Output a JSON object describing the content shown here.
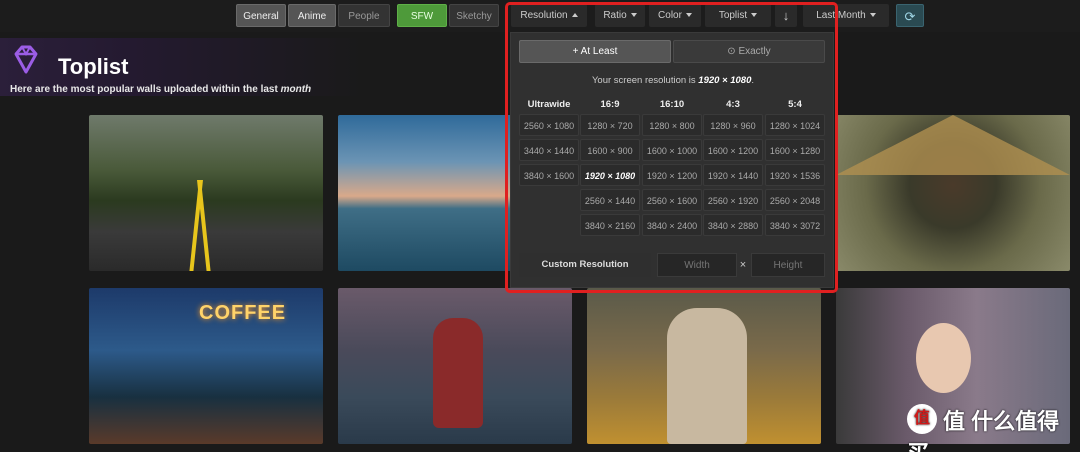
{
  "toolbar": {
    "general": "General",
    "anime": "Anime",
    "people": "People",
    "sfw": "SFW",
    "sketchy": "Sketchy",
    "resolution": "Resolution",
    "ratio": "Ratio",
    "color": "Color",
    "toplist": "Toplist",
    "sort_icon": "↓",
    "range": "Last Month",
    "refresh_icon": "⟳"
  },
  "header": {
    "title": "Toplist",
    "subtitle_prefix": "Here are the most popular walls uploaded within the last ",
    "subtitle_period": "month"
  },
  "resolution_menu": {
    "at_least_label": "+ At Least",
    "exactly_label": "⊙ Exactly",
    "note_prefix": "Your screen resolution is ",
    "note_value": "1920 × 1080",
    "note_suffix": ".",
    "columns": [
      {
        "head": "Ultrawide",
        "items": [
          "2560 × 1080",
          "3440 × 1440",
          "3840 × 1600"
        ]
      },
      {
        "head": "16:9",
        "items": [
          "1280 × 720",
          "1600 × 900",
          "1920 × 1080",
          "2560 × 1440",
          "3840 × 2160"
        ]
      },
      {
        "head": "16:10",
        "items": [
          "1280 × 800",
          "1600 × 1000",
          "1920 × 1200",
          "2560 × 1600",
          "3840 × 2400"
        ]
      },
      {
        "head": "4:3",
        "items": [
          "1280 × 960",
          "1600 × 1200",
          "1920 × 1440",
          "2560 × 1920",
          "3840 × 2880"
        ]
      },
      {
        "head": "5:4",
        "items": [
          "1280 × 1024",
          "1600 × 1280",
          "1920 × 1536",
          "2560 × 2048",
          "3840 × 3072"
        ]
      }
    ],
    "selected": "1920 × 1080",
    "custom_label": "Custom Resolution",
    "width_placeholder": "Width",
    "times": "×",
    "height_placeholder": "Height"
  },
  "thumb_text": {
    "coffee": "COFFEE"
  },
  "watermark": {
    "text": "值 什么值得买"
  },
  "colors": {
    "highlight": "#e02020",
    "sfw": "#4e9a3a",
    "refresh": "#2a4a52",
    "logo": "#9b5de5"
  }
}
